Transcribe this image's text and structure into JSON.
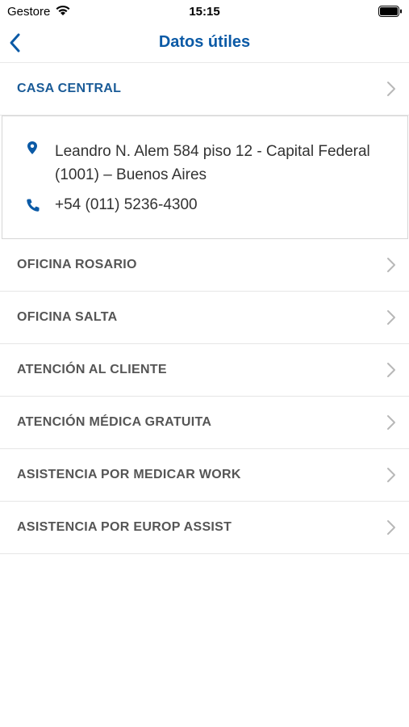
{
  "status_bar": {
    "carrier": "Gestore",
    "time": "15:15"
  },
  "nav": {
    "title": "Datos útiles"
  },
  "sections": [
    {
      "label": "CASA CENTRAL"
    },
    {
      "label": "OFICINA ROSARIO"
    },
    {
      "label": "OFICINA SALTA"
    },
    {
      "label": "ATENCIÓN AL CLIENTE"
    },
    {
      "label": "ATENCIÓN MÉDICA GRATUITA"
    },
    {
      "label": "ASISTENCIA POR MEDICAR WORK"
    },
    {
      "label": "ASISTENCIA POR EUROP ASSIST"
    }
  ],
  "detail": {
    "address": "Leandro N. Alem 584 piso 12 - Capital Federal (1001) – Buenos Aires",
    "phone": "+54 (011) 5236-4300"
  },
  "colors": {
    "accent": "#0b5aa6",
    "active_label": "#1a5b97",
    "label": "#555555"
  }
}
